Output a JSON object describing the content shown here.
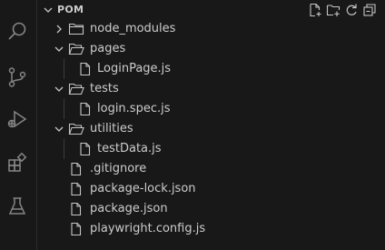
{
  "explorer": {
    "section_title": "POM",
    "actions": [
      "new-file-icon",
      "new-folder-icon",
      "refresh-icon",
      "collapse-all-icon"
    ]
  },
  "activity_bar": {
    "items": [
      "search-icon",
      "source-control-icon",
      "run-debug-icon",
      "extensions-icon",
      "testing-icon"
    ]
  },
  "tree": {
    "node_modules": "node_modules",
    "pages": "pages",
    "login_page": "LoginPage.js",
    "tests": "tests",
    "login_spec": "login.spec.js",
    "utilities": "utilities",
    "test_data": "testData.js",
    "gitignore": ".gitignore",
    "package_lock": "package-lock.json",
    "package_json": "package.json",
    "playwright_config": "playwright.config.js"
  },
  "colors": {
    "background": "#181818",
    "text": "#cccccc",
    "icon": "#c5c5c5",
    "guide": "#3c3c3c"
  }
}
